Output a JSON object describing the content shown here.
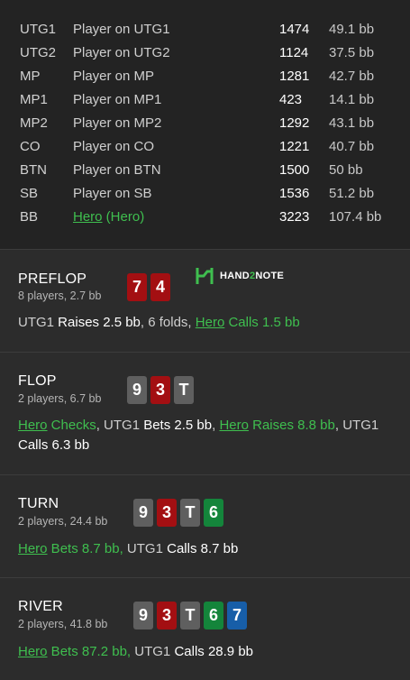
{
  "players": [
    {
      "pos": "UTG1",
      "name": "Player on UTG1",
      "chips": "1474",
      "bb": "49.1 bb"
    },
    {
      "pos": "UTG2",
      "name": "Player on UTG2",
      "chips": "1124",
      "bb": "37.5 bb"
    },
    {
      "pos": "MP",
      "name": "Player on MP",
      "chips": "1281",
      "bb": "42.7 bb"
    },
    {
      "pos": "MP1",
      "name": "Player on MP1",
      "chips": "423",
      "bb": "14.1 bb"
    },
    {
      "pos": "MP2",
      "name": "Player on MP2",
      "chips": "1292",
      "bb": "43.1 bb"
    },
    {
      "pos": "CO",
      "name": "Player on CO",
      "chips": "1221",
      "bb": "40.7 bb"
    },
    {
      "pos": "BTN",
      "name": "Player on BTN",
      "chips": "1500",
      "bb": "50 bb"
    },
    {
      "pos": "SB",
      "name": "Player on SB",
      "chips": "1536",
      "bb": "51.2 bb"
    },
    {
      "pos": "BB",
      "name_link": "Hero",
      "name_suffix": " (Hero)",
      "chips": "3223",
      "bb": "107.4 bb"
    }
  ],
  "logo": {
    "text_pre": "HAND",
    "text_two": "2",
    "text_post": "NOTE"
  },
  "preflop": {
    "title": "PREFLOP",
    "sub": "8 players, 2.7 bb",
    "cards": [
      {
        "rank": "7",
        "color": "red"
      },
      {
        "rank": "4",
        "color": "red"
      }
    ],
    "a1_player": "UTG1",
    "a1_action": " Raises 2.5 bb",
    "a2": ", 6 folds, ",
    "a3_hero": "Hero",
    "a3_action": " Calls 1.5 bb"
  },
  "flop": {
    "title": "FLOP",
    "sub": "2 players, 6.7 bb",
    "cards": [
      {
        "rank": "9",
        "color": "gray"
      },
      {
        "rank": "3",
        "color": "red"
      },
      {
        "rank": "T",
        "color": "gray"
      }
    ],
    "a1_hero": "Hero",
    "a1_action": " Checks",
    "a2_sep": ", UTG1",
    "a2_action": " Bets 2.5 bb",
    "a3_sep": ", ",
    "a3_hero": "Hero",
    "a3_action": " Raises 8.8 bb",
    "a4_sep": ", UTG1",
    "a4_action": " Calls 6.3 bb"
  },
  "turn": {
    "title": "TURN",
    "sub": "2 players, 24.4 bb",
    "cards": [
      {
        "rank": "9",
        "color": "gray"
      },
      {
        "rank": "3",
        "color": "red"
      },
      {
        "rank": "T",
        "color": "gray"
      },
      {
        "rank": "6",
        "color": "green"
      }
    ],
    "a1_hero": "Hero",
    "a1_action": " Bets 8.7 bb,",
    "a2_sep": " UTG1",
    "a2_action": " Calls 8.7 bb"
  },
  "river": {
    "title": "RIVER",
    "sub": "2 players, 41.8 bb",
    "cards": [
      {
        "rank": "9",
        "color": "gray"
      },
      {
        "rank": "3",
        "color": "red"
      },
      {
        "rank": "T",
        "color": "gray"
      },
      {
        "rank": "6",
        "color": "green"
      },
      {
        "rank": "7",
        "color": "blue"
      }
    ],
    "a1_hero": "Hero",
    "a1_action": " Bets 87.2 bb,",
    "a2_sep": " UTG1",
    "a2_action": " Calls 28.9 bb"
  },
  "colors": {
    "hero": "#3fbf4f",
    "card_red": "#a30f12",
    "card_gray": "#5f5f5f",
    "card_green": "#14853b",
    "card_blue": "#175ea8"
  }
}
